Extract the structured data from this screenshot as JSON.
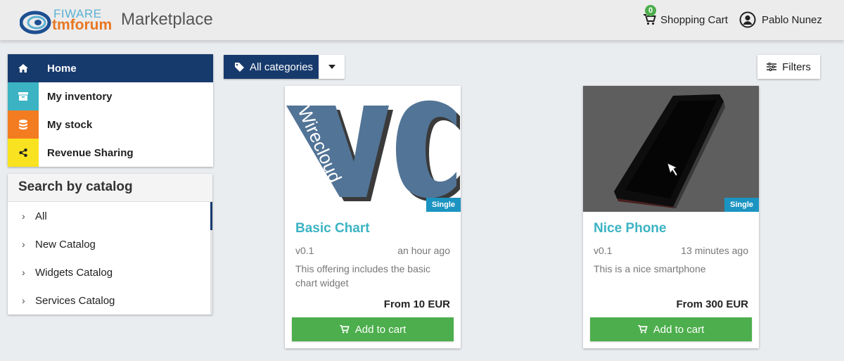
{
  "header": {
    "logo_top": "FIWARE",
    "logo_bottom": "tmforum",
    "title": "Marketplace",
    "cart_label": "Shopping Cart",
    "cart_count": "0",
    "user_name": "Pablo Nunez"
  },
  "sidebar": {
    "items": [
      {
        "label": "Home",
        "icon": "home-icon",
        "active": true
      },
      {
        "label": "My inventory",
        "icon": "archive-icon"
      },
      {
        "label": "My stock",
        "icon": "database-icon"
      },
      {
        "label": "Revenue Sharing",
        "icon": "share-icon"
      }
    ]
  },
  "catalog": {
    "title": "Search by catalog",
    "items": [
      {
        "label": "All",
        "selected": true
      },
      {
        "label": "New Catalog"
      },
      {
        "label": "Widgets Catalog"
      },
      {
        "label": "Services Catalog"
      }
    ]
  },
  "toolbar": {
    "category_label": "All categories",
    "filters_label": "Filters"
  },
  "offerings": [
    {
      "image_text": "Wirecloud",
      "badge": "Single",
      "name": "Basic Chart",
      "version": "v0.1",
      "time": "an hour ago",
      "description": "This offering includes the basic chart widget",
      "price": "From 10 EUR",
      "button": "Add to cart"
    },
    {
      "badge": "Single",
      "name": "Nice Phone",
      "version": "v0.1",
      "time": "13 minutes ago",
      "description": "This is a nice smartphone",
      "price": "From 300 EUR",
      "button": "Add to cart"
    }
  ],
  "colors": {
    "navy": "#173a6d",
    "teal": "#3bb3c3",
    "orange": "#f47c20",
    "yellow": "#f9e21f",
    "green": "#4cae4c",
    "badge_blue": "#1b94c2"
  }
}
